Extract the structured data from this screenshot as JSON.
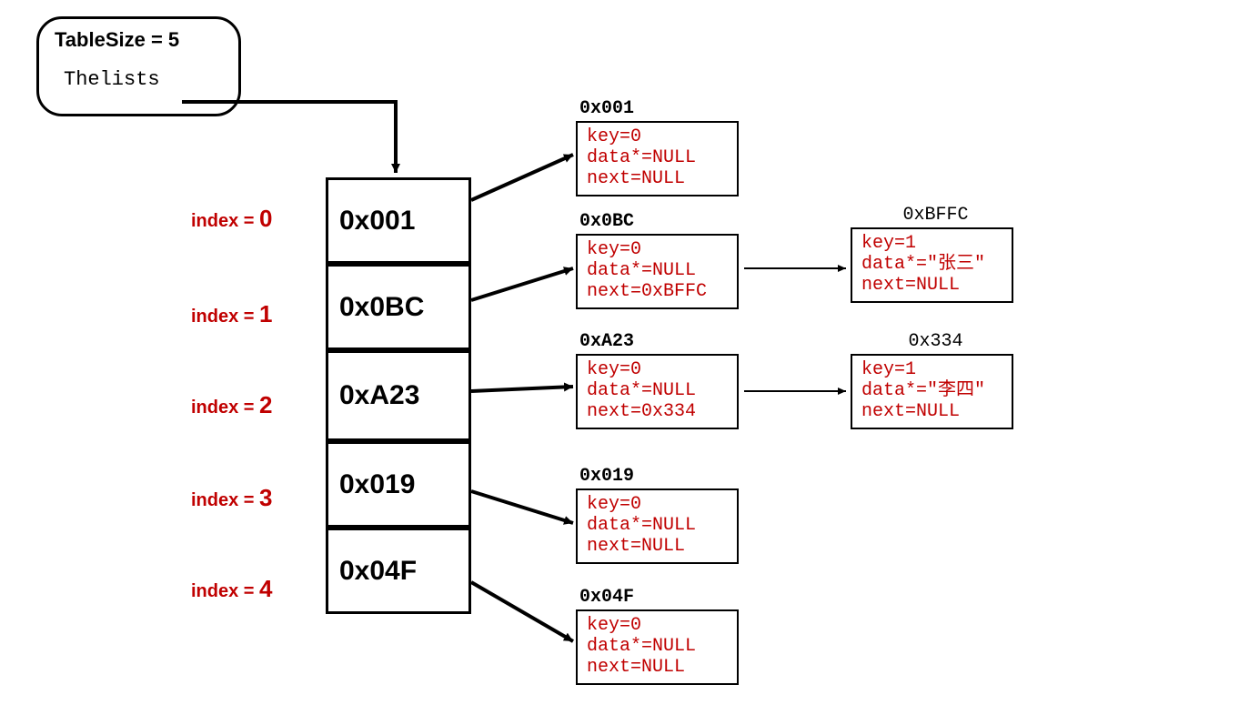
{
  "header": {
    "title": "TableSize = 5",
    "sub": "Thelists"
  },
  "indices": {
    "prefix": "index = ",
    "v0": "0",
    "v1": "1",
    "v2": "2",
    "v3": "3",
    "v4": "4"
  },
  "buckets": {
    "b0": "0x001",
    "b1": "0x0BC",
    "b2": "0xA23",
    "b3": "0x019",
    "b4": "0x04F"
  },
  "nodes": {
    "n001": {
      "addr": "0x001",
      "l1": "key=0",
      "l2": "data*=NULL",
      "l3": "next=NULL"
    },
    "n0BC": {
      "addr": "0x0BC",
      "l1": "key=0",
      "l2": "data*=NULL",
      "l3": "next=0xBFFC"
    },
    "nA23": {
      "addr": "0xA23",
      "l1": "key=0",
      "l2": "data*=NULL",
      "l3": "next=0x334"
    },
    "n019": {
      "addr": "0x019",
      "l1": "key=0",
      "l2": "data*=NULL",
      "l3": "next=NULL"
    },
    "n04F": {
      "addr": "0x04F",
      "l1": "key=0",
      "l2": "data*=NULL",
      "l3": "next=NULL"
    },
    "nBFFC": {
      "addr": "0xBFFC",
      "l1": "key=1",
      "l2": "data*=\"张三\"",
      "l3": "next=NULL"
    },
    "n334": {
      "addr": "0x334",
      "l1": "key=1",
      "l2": "data*=\"李四\"",
      "l3": "next=NULL"
    }
  }
}
